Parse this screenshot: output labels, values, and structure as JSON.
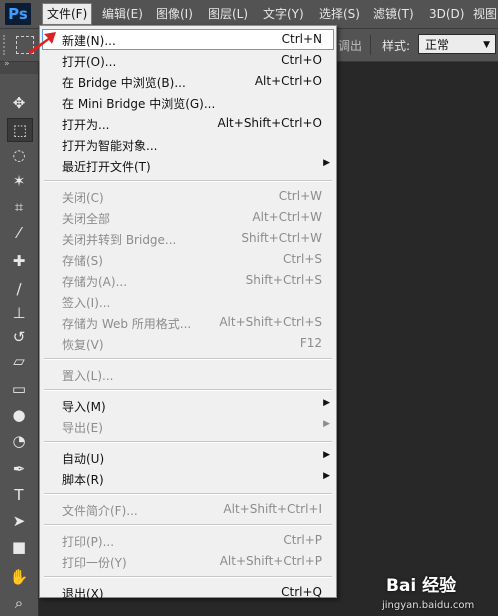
{
  "app": {
    "logo": "Ps"
  },
  "menubar": [
    {
      "label": "文件(F)",
      "active": true
    },
    {
      "label": "编辑(E)"
    },
    {
      "label": "图像(I)"
    },
    {
      "label": "图层(L)"
    },
    {
      "label": "文字(Y)"
    },
    {
      "label": "选择(S)"
    },
    {
      "label": "滤镜(T)"
    },
    {
      "label": "3D(D)"
    },
    {
      "label": "视图"
    }
  ],
  "options_bar": {
    "partial_text": "调出",
    "style_label": "样式:",
    "style_value": "正常"
  },
  "file_menu": [
    {
      "label": "新建(N)...",
      "shortcut": "Ctrl+N",
      "highlighted": true
    },
    {
      "label": "打开(O)...",
      "shortcut": "Ctrl+O"
    },
    {
      "label": "在 Bridge 中浏览(B)...",
      "shortcut": "Alt+Ctrl+O"
    },
    {
      "label": "在 Mini Bridge 中浏览(G)...",
      "shortcut": ""
    },
    {
      "label": "打开为...",
      "shortcut": "Alt+Shift+Ctrl+O"
    },
    {
      "label": "打开为智能对象...",
      "shortcut": ""
    },
    {
      "label": "最近打开文件(T)",
      "shortcut": "",
      "submenu": true
    },
    {
      "separator": true
    },
    {
      "label": "关闭(C)",
      "shortcut": "Ctrl+W",
      "disabled": true
    },
    {
      "label": "关闭全部",
      "shortcut": "Alt+Ctrl+W",
      "disabled": true
    },
    {
      "label": "关闭并转到 Bridge...",
      "shortcut": "Shift+Ctrl+W",
      "disabled": true
    },
    {
      "label": "存储(S)",
      "shortcut": "Ctrl+S",
      "disabled": true
    },
    {
      "label": "存储为(A)...",
      "shortcut": "Shift+Ctrl+S",
      "disabled": true
    },
    {
      "label": "签入(I)...",
      "shortcut": "",
      "disabled": true
    },
    {
      "label": "存储为 Web 所用格式...",
      "shortcut": "Alt+Shift+Ctrl+S",
      "disabled": true
    },
    {
      "label": "恢复(V)",
      "shortcut": "F12",
      "disabled": true
    },
    {
      "separator": true
    },
    {
      "label": "置入(L)...",
      "shortcut": "",
      "disabled": true
    },
    {
      "separator": true
    },
    {
      "label": "导入(M)",
      "shortcut": "",
      "submenu": true
    },
    {
      "label": "导出(E)",
      "shortcut": "",
      "submenu": true,
      "disabled": true
    },
    {
      "separator": true
    },
    {
      "label": "自动(U)",
      "shortcut": "",
      "submenu": true
    },
    {
      "label": "脚本(R)",
      "shortcut": "",
      "submenu": true
    },
    {
      "separator": true
    },
    {
      "label": "文件简介(F)...",
      "shortcut": "Alt+Shift+Ctrl+I",
      "disabled": true
    },
    {
      "separator": true
    },
    {
      "label": "打印(P)...",
      "shortcut": "Ctrl+P",
      "disabled": true
    },
    {
      "label": "打印一份(Y)",
      "shortcut": "Alt+Shift+Ctrl+P",
      "disabled": true
    },
    {
      "separator": true
    },
    {
      "label": "退出(X)",
      "shortcut": "Ctrl+Q"
    }
  ],
  "tools": [
    {
      "name": "move-tool-icon",
      "glyph": "✥"
    },
    {
      "name": "marquee-tool-icon",
      "glyph": "⬚",
      "selected": true
    },
    {
      "name": "lasso-tool-icon",
      "glyph": "◌"
    },
    {
      "name": "magic-wand-tool-icon",
      "glyph": "✶"
    },
    {
      "name": "crop-tool-icon",
      "glyph": "⌗"
    },
    {
      "name": "eyedropper-tool-icon",
      "glyph": "⁄"
    },
    {
      "name": "healing-brush-tool-icon",
      "glyph": "✚"
    },
    {
      "name": "brush-tool-icon",
      "glyph": "∕"
    },
    {
      "name": "clone-stamp-tool-icon",
      "glyph": "⊥"
    },
    {
      "name": "history-brush-tool-icon",
      "glyph": "↺"
    },
    {
      "name": "eraser-tool-icon",
      "glyph": "▱"
    },
    {
      "name": "gradient-tool-icon",
      "glyph": "▭"
    },
    {
      "name": "blur-tool-icon",
      "glyph": "●"
    },
    {
      "name": "dodge-tool-icon",
      "glyph": "◔"
    },
    {
      "name": "pen-tool-icon",
      "glyph": "✒"
    },
    {
      "name": "type-tool-icon",
      "glyph": "T"
    },
    {
      "name": "path-selection-tool-icon",
      "glyph": "➤"
    },
    {
      "name": "shape-tool-icon",
      "glyph": "■"
    },
    {
      "name": "hand-tool-icon",
      "glyph": "✋"
    },
    {
      "name": "zoom-tool-icon",
      "glyph": "⌕"
    }
  ],
  "watermark": {
    "brand": "Bai 经验",
    "url": "jingyan.baidu.com"
  }
}
